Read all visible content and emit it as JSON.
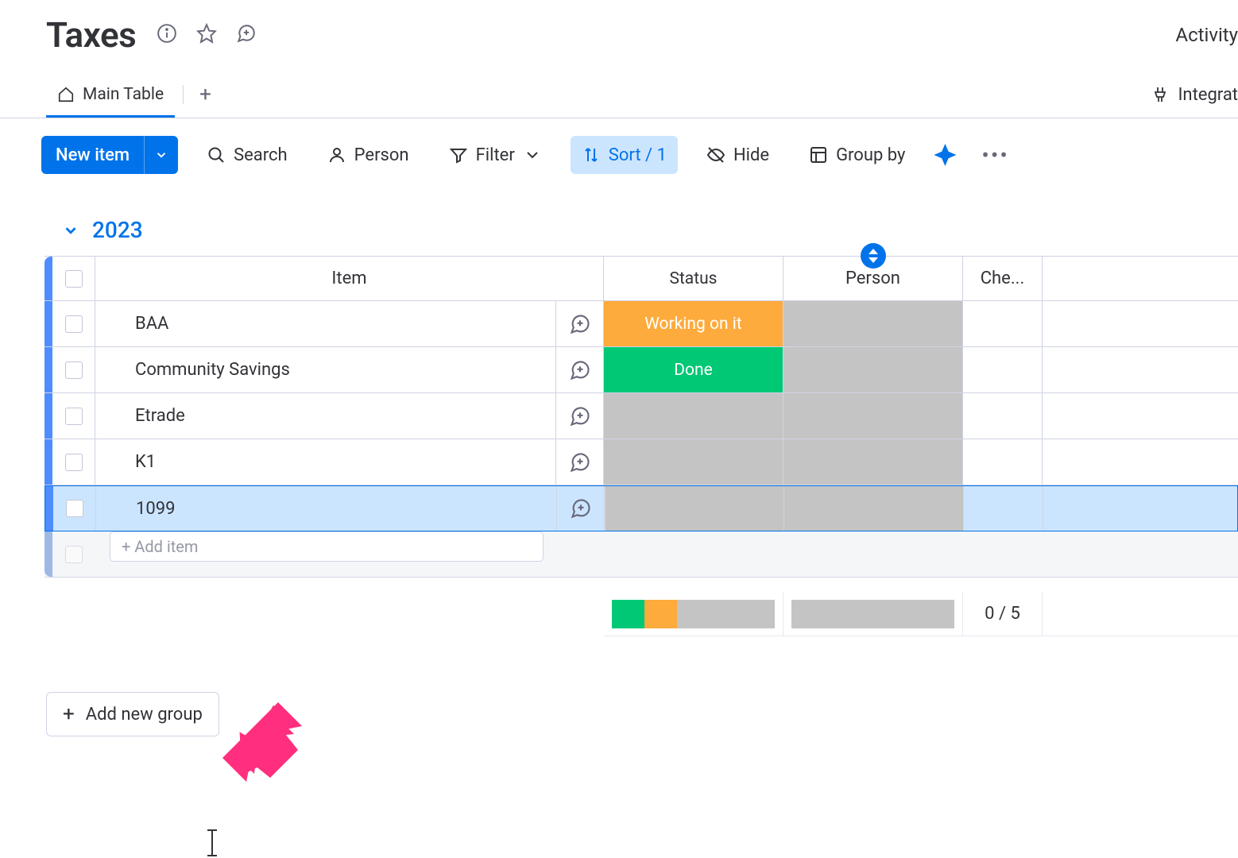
{
  "header": {
    "title": "Taxes",
    "activity": "Activity"
  },
  "tabs": {
    "main": "Main Table",
    "integrate": "Integrat"
  },
  "toolbar": {
    "new_item": "New item",
    "search": "Search",
    "person": "Person",
    "filter": "Filter",
    "sort": "Sort / 1",
    "hide": "Hide",
    "group_by": "Group by"
  },
  "group": {
    "name": "2023",
    "columns": {
      "item": "Item",
      "status": "Status",
      "person": "Person",
      "che": "Che..."
    },
    "rows": [
      {
        "item": "BAA",
        "status": "Working on it",
        "status_class": "status-working"
      },
      {
        "item": "Community Savings",
        "status": "Done",
        "status_class": "status-done"
      },
      {
        "item": "Etrade",
        "status": "",
        "status_class": "status-blank"
      },
      {
        "item": "K1",
        "status": "",
        "status_class": "status-blank"
      },
      {
        "item": "1099",
        "status": "",
        "status_class": "status-blank",
        "selected": true
      }
    ],
    "add_placeholder": "+ Add item",
    "summary_count": "0 / 5"
  },
  "add_group": "Add new group"
}
